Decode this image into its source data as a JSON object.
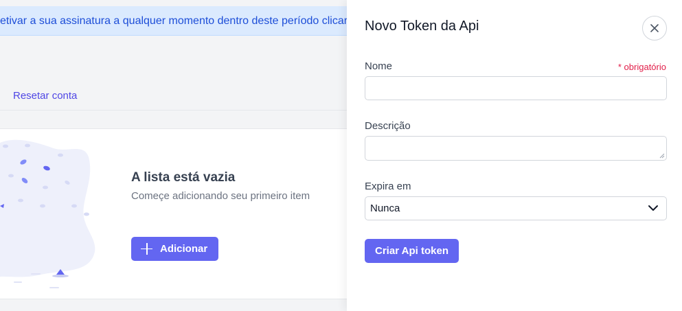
{
  "background": {
    "banner_text": "etivar a sua assinatura a qualquer momento dentro deste período clicar",
    "reset_link": "Resetar conta",
    "empty_state": {
      "title": "A lista está vazia",
      "description": "Começe adicionando seu primeiro item",
      "add_button": "Adicionar"
    }
  },
  "panel": {
    "title": "Novo Token da Api",
    "close_icon": "close-icon",
    "name_label": "Nome",
    "required_text": "* obrigatório",
    "name_value": "",
    "description_label": "Descrição",
    "description_value": "",
    "expires_label": "Expira em",
    "expires_selected": "Nunca",
    "submit_button": "Criar Api token"
  },
  "colors": {
    "accent": "#6366f1",
    "required": "#e11d48",
    "banner_bg": "#dbeafe",
    "banner_text": "#1d4ed8"
  }
}
